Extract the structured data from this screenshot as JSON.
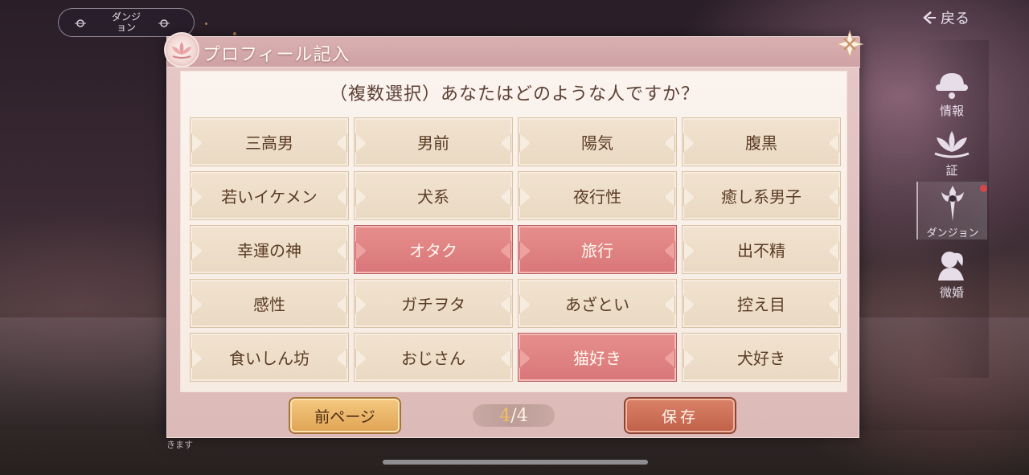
{
  "scene": {
    "label": "ダンジョン"
  },
  "nav": {
    "back_label": "戻る"
  },
  "sidebar": {
    "items": [
      {
        "label": "情報",
        "icon": "info-icon"
      },
      {
        "label": "証",
        "icon": "lotus-icon"
      },
      {
        "label": "ダンジョン",
        "icon": "dungeon-icon"
      },
      {
        "label": "微婚",
        "icon": "couple-icon"
      }
    ]
  },
  "dialog": {
    "title": "プロフィール記入",
    "question": "（複数選択）あなたはどのような人ですか？",
    "options": [
      {
        "label": "三高男",
        "selected": false
      },
      {
        "label": "男前",
        "selected": false
      },
      {
        "label": "陽気",
        "selected": false
      },
      {
        "label": "腹黒",
        "selected": false
      },
      {
        "label": "若いイケメン",
        "selected": false
      },
      {
        "label": "犬系",
        "selected": false
      },
      {
        "label": "夜行性",
        "selected": false
      },
      {
        "label": "癒し系男子",
        "selected": false
      },
      {
        "label": "幸運の神",
        "selected": false
      },
      {
        "label": "オタク",
        "selected": true
      },
      {
        "label": "旅行",
        "selected": true
      },
      {
        "label": "出不精",
        "selected": false
      },
      {
        "label": "感性",
        "selected": false
      },
      {
        "label": "ガチヲタ",
        "selected": false
      },
      {
        "label": "あざとい",
        "selected": false
      },
      {
        "label": "控え目",
        "selected": false
      },
      {
        "label": "食いしん坊",
        "selected": false
      },
      {
        "label": "おじさん",
        "selected": false
      },
      {
        "label": "猫好き",
        "selected": true
      },
      {
        "label": "犬好き",
        "selected": false
      }
    ],
    "prev_label": "前ページ",
    "save_label": "保存",
    "page_current": "4",
    "page_total": "/4"
  },
  "bottom_hint": "きます",
  "colors": {
    "selected_option": "#d9777a",
    "option": "#eedfcb",
    "prev_button": "#e8b266",
    "save_button": "#c96c52"
  }
}
